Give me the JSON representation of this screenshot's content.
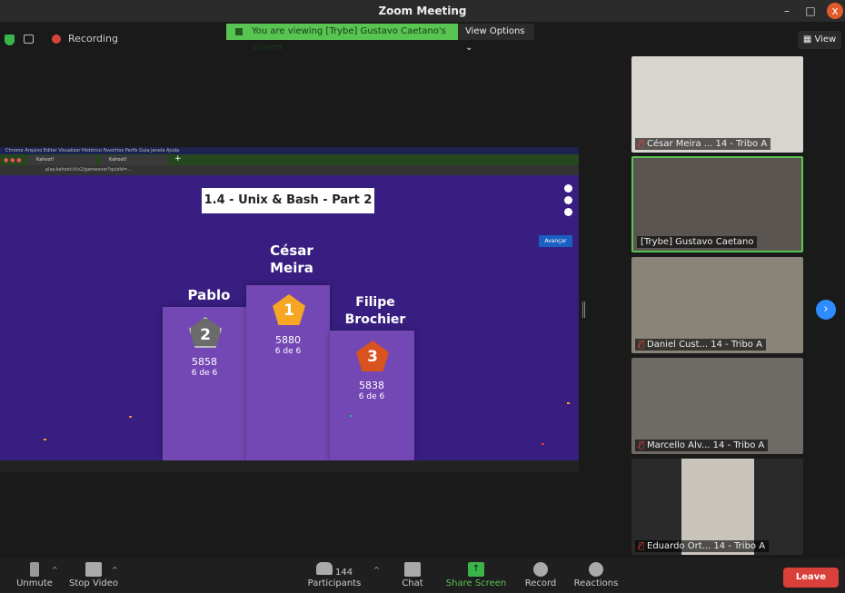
{
  "window": {
    "title": "Zoom Meeting",
    "minimize": "–",
    "maximize": "□",
    "close": "x"
  },
  "topbar": {
    "recording": "Recording",
    "banner": "You are viewing [Trybe] Gustavo Caetano's screen",
    "view_options": "View Options ⌄",
    "view": "View"
  },
  "shared": {
    "mac_menu": "Chrome   Arquivo   Editar   Visualizar   Histórico   Favoritos   Perfis   Guia   Janela   Ajuda",
    "tabs": [
      "Kahoot!",
      "Kahoot!"
    ],
    "address": "play.kahoot.it/v2/gameover?quizId=...",
    "quiz_title": "1.4 - Unix & Bash - Part 2",
    "advance_button": "Avançar",
    "podium": [
      {
        "rank": "1",
        "name_line1": "César",
        "name_line2": "Meira",
        "score": "5880",
        "correct": "6 de 6",
        "color": "#f5a623"
      },
      {
        "rank": "2",
        "name_line1": "Pablo",
        "name_line2": "",
        "score": "5858",
        "correct": "6 de 6",
        "color": "#6b6b6b"
      },
      {
        "rank": "3",
        "name_line1": "Filipe",
        "name_line2": "Brochier",
        "score": "5838",
        "correct": "6 de 6",
        "color": "#d9531e"
      }
    ]
  },
  "participants": [
    {
      "name": "César Meira ... 14 - Tribo A",
      "muted": true
    },
    {
      "name": "[Trybe] Gustavo Caetano",
      "muted": false
    },
    {
      "name": "Daniel Cust... 14 - Tribo A",
      "muted": true
    },
    {
      "name": "Marcello Alv... 14 - Tribo A",
      "muted": true
    },
    {
      "name": "Eduardo Ort... 14 - Tribo A",
      "muted": true
    }
  ],
  "toolbar": {
    "unmute": "Unmute",
    "stop_video": "Stop Video",
    "participants": "Participants",
    "participant_count": "144",
    "chat": "Chat",
    "share_screen": "Share Screen",
    "record": "Record",
    "reactions": "Reactions",
    "leave": "Leave"
  }
}
